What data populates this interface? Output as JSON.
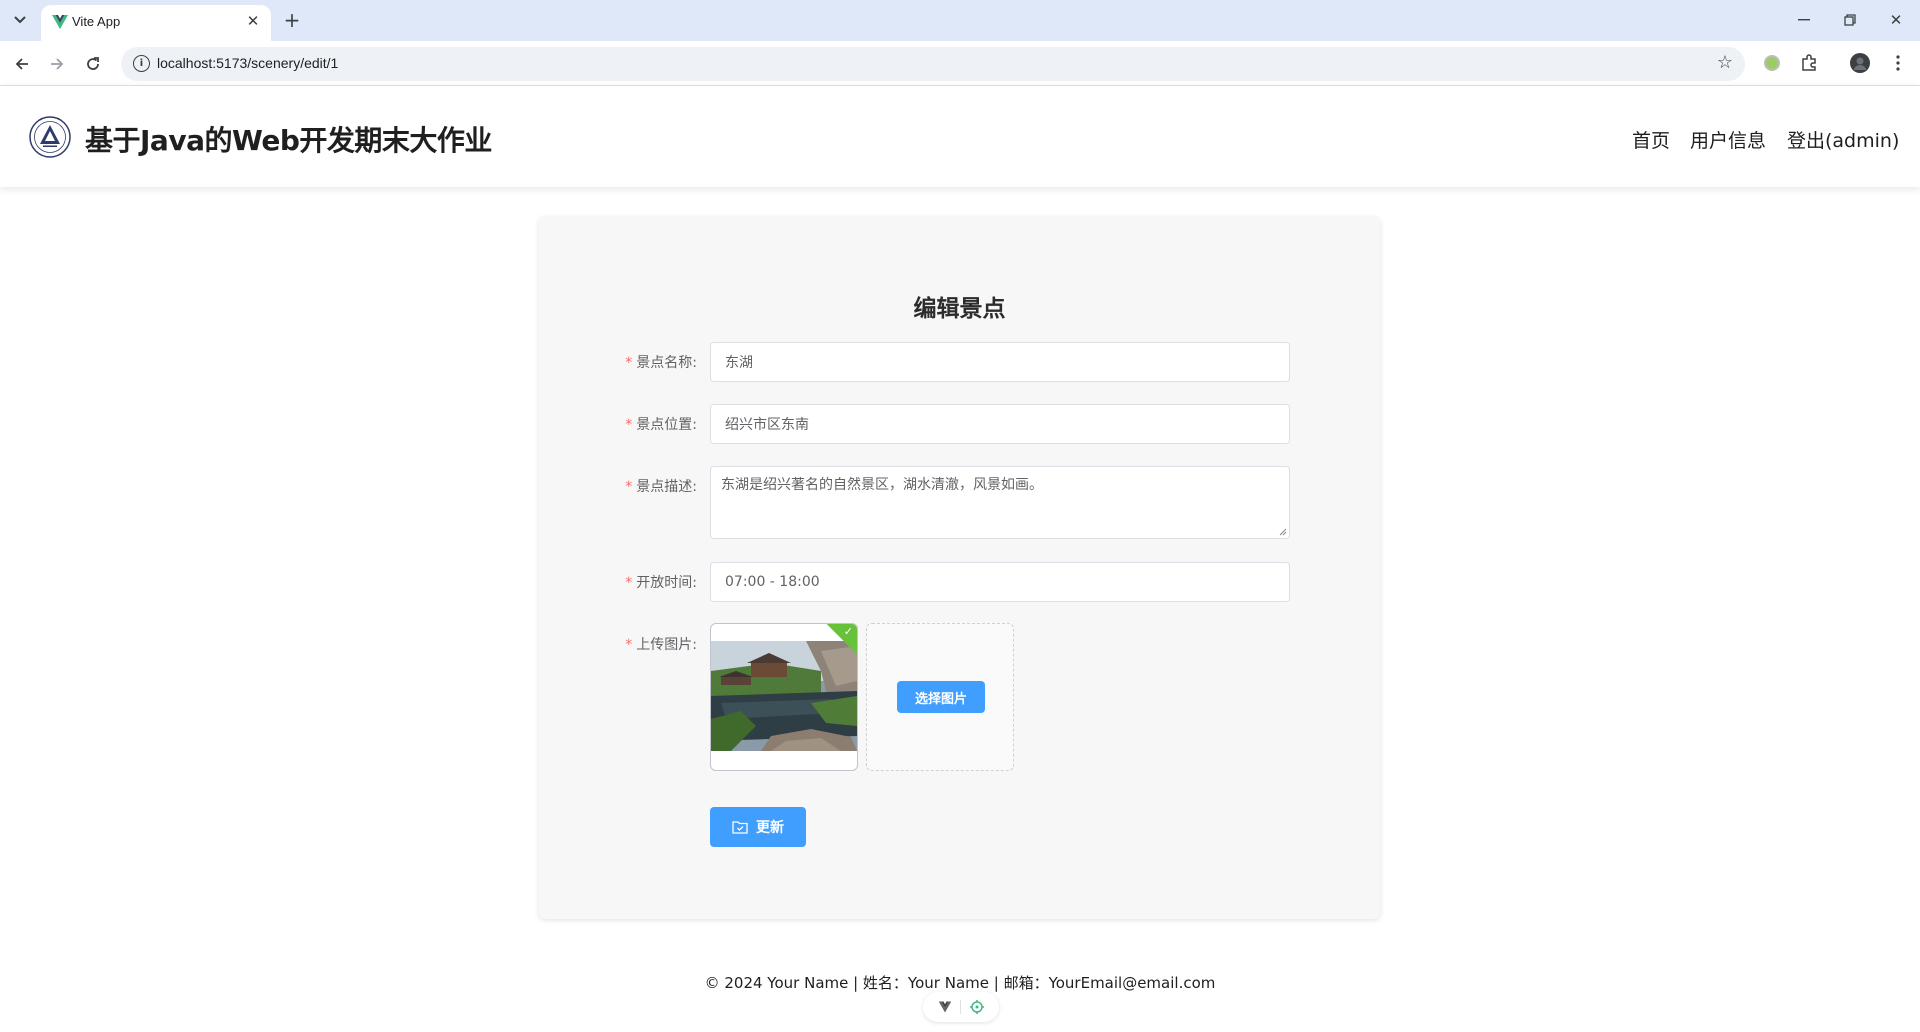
{
  "browser": {
    "tab_title": "Vite App",
    "url": "localhost:5173/scenery/edit/1"
  },
  "header": {
    "title": "基于Java的Web开发期末大作业",
    "nav": [
      "首页",
      "用户信息",
      "登出(admin)"
    ]
  },
  "form": {
    "title": "编辑景点",
    "fields": [
      {
        "label": "景点名称:",
        "value": "东湖"
      },
      {
        "label": "景点位置:",
        "value": "绍兴市区东南"
      },
      {
        "label": "景点描述:",
        "value": "东湖是绍兴著名的自然景区，湖水清澈，风景如画。"
      },
      {
        "label": "开放时间:",
        "value": "07:00 - 18:00"
      },
      {
        "label": "上传图片:"
      }
    ],
    "required_mark": "*",
    "choose_image_label": "选择图片",
    "submit_label": "更新"
  },
  "footer": {
    "text": "© 2024 Your Name | 姓名：Your Name | 邮箱：YourEmail@email.com"
  },
  "colors": {
    "primary": "#409eff",
    "success": "#67c23a",
    "required": "#f56c6c"
  }
}
